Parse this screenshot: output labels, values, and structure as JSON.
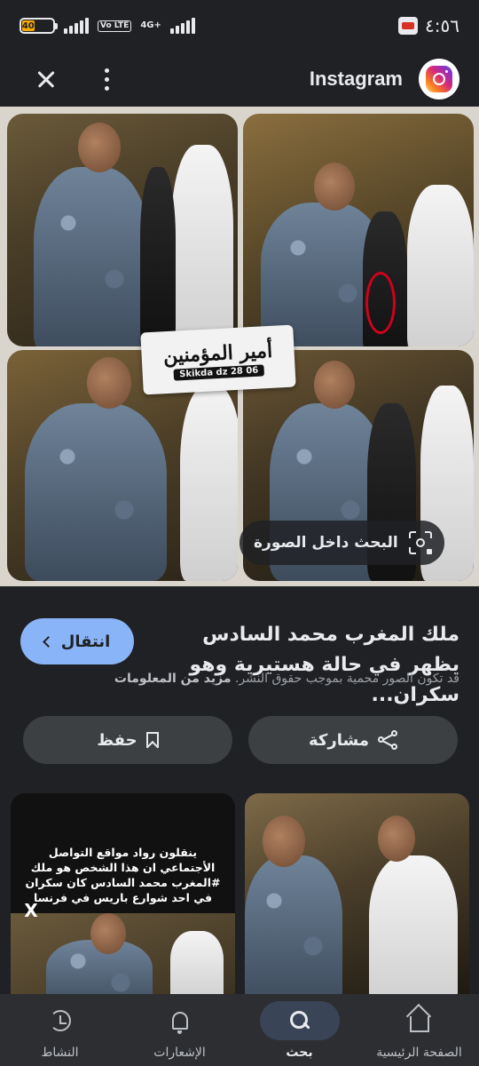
{
  "status_bar": {
    "time": "٤:٥٦",
    "battery_level": "40",
    "network": "4G+",
    "volte": "Vo LTE"
  },
  "header": {
    "site_name": "Instagram",
    "close_icon": "close-icon",
    "more_icon": "more-vert-icon"
  },
  "image": {
    "watermark_title": "أمير المؤمنين",
    "watermark_sub": "Skikda dz 28 06",
    "lens_label": "البحث داخل الصورة"
  },
  "result": {
    "visit_label": "انتقال",
    "title": "ملك المغرب محمد السادس يظهر في حالة هستيرية وهو سكران...",
    "copyright": "قد تكون الصور محمية بموجب حقوق النشر.",
    "more_info": "مزيد من المعلومات"
  },
  "actions": {
    "share_label": "مشاركة",
    "save_label": "حفظ"
  },
  "related": {
    "left_caption": "ينقلون رواد مواقع التواصل الأجتماعي ان هذا الشخص هو ملك #المغرب محمد السادس كان سكران في احد شوارع باريس في فرنسا",
    "left_logo": "X"
  },
  "bottom_nav": {
    "items": [
      {
        "label": "الصفحة الرئيسية",
        "icon": "home-icon"
      },
      {
        "label": "بحث",
        "icon": "search-icon"
      },
      {
        "label": "الإشعارات",
        "icon": "bell-icon"
      },
      {
        "label": "النشاط",
        "icon": "activity-icon"
      }
    ]
  },
  "colors": {
    "background": "#202124",
    "accent": "#8ab4f8",
    "button_bg": "#3c4043"
  }
}
